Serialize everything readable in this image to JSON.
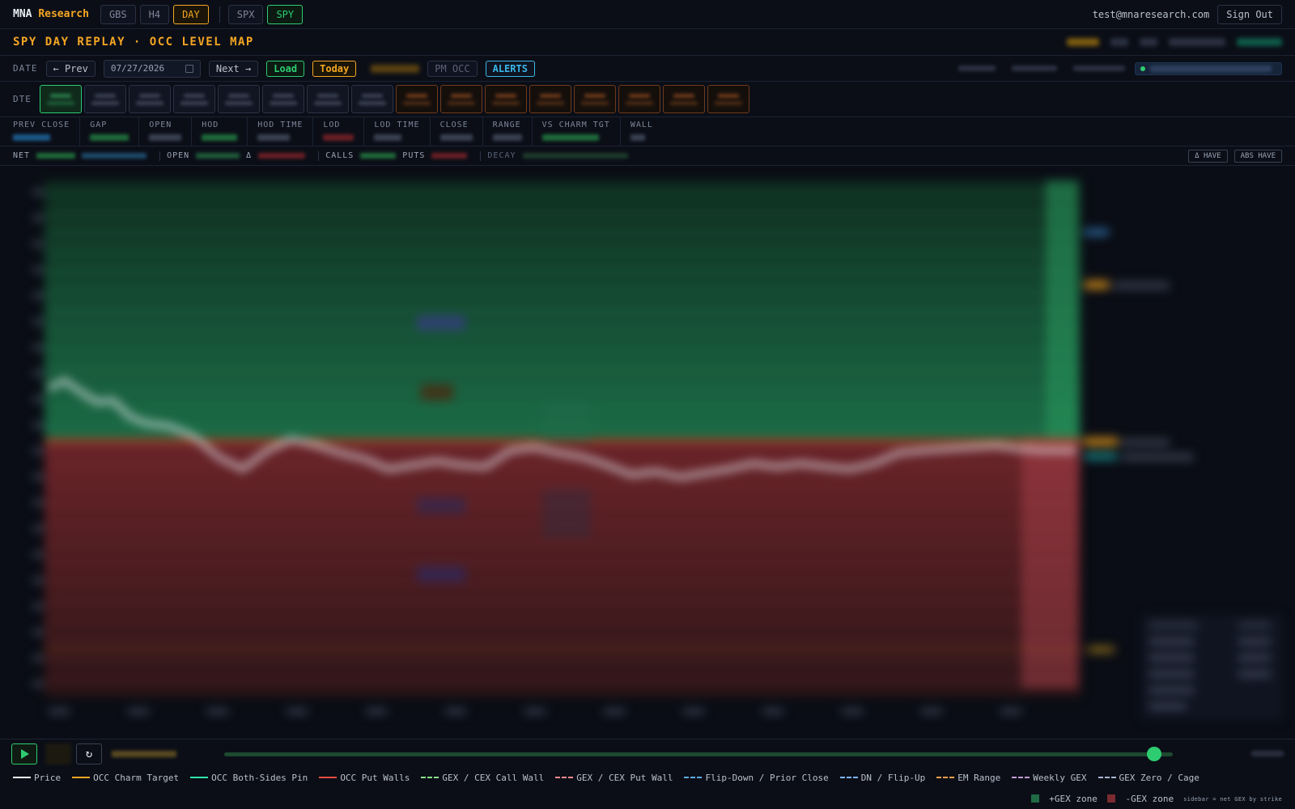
{
  "topbar": {
    "brand_main": "MNA",
    "brand_accent": "Research",
    "modes": [
      "GBS",
      "H4",
      "DAY"
    ],
    "active_mode": "DAY",
    "symbols": [
      "SPX",
      "SPY"
    ],
    "active_symbol": "SPY",
    "user_email": "test@mnaresearch.com",
    "signout_label": "Sign Out"
  },
  "page": {
    "title": "SPY DAY REPLAY · OCC LEVEL MAP"
  },
  "controls": {
    "date_label": "DATE",
    "prev_label": "← Prev",
    "date_value": "07/27/2026",
    "next_label": "Next →",
    "load_label": "Load",
    "today_label": "Today",
    "pm_occ_label": "PM OCC",
    "alerts_label": "ALERTS"
  },
  "dte": {
    "label": "DTE"
  },
  "stats": {
    "labels": [
      "PREV CLOSE",
      "GAP",
      "OPEN",
      "HOD",
      "HOD TIME",
      "LOD",
      "LOD TIME",
      "CLOSE",
      "RANGE",
      "VS CHARM TGT",
      "WALL"
    ]
  },
  "netbar": {
    "net_label": "NET",
    "open_label": "OPEN",
    "delta_label": "Δ",
    "calls_label": "CALLS",
    "puts_label": "PUTS",
    "decay_label": "DECAY",
    "delta_have_label": "Δ HAVE",
    "abs_have_label": "ABS HAVE"
  },
  "player": {
    "reset_icon": "↻",
    "progress": 0.98
  },
  "legend": {
    "items": [
      {
        "label": "Price",
        "color": "#ffffff",
        "style": "solid"
      },
      {
        "label": "OCC Charm Target",
        "color": "#f5a623",
        "style": "solid"
      },
      {
        "label": "OCC Both-Sides Pin",
        "color": "#2ee6a8",
        "style": "solid"
      },
      {
        "label": "OCC Put Walls",
        "color": "#e74c3c",
        "style": "solid"
      },
      {
        "label": "GEX / CEX Call Wall",
        "color": "#8be08b",
        "style": "dashed"
      },
      {
        "label": "GEX / CEX Put Wall",
        "color": "#ff8c8c",
        "style": "dashed"
      },
      {
        "label": "Flip-Down / Prior Close",
        "color": "#5dade2",
        "style": "dashed"
      },
      {
        "label": "DN / Flip-Up",
        "color": "#7fb3ff",
        "style": "dashed"
      },
      {
        "label": "EM Range",
        "color": "#f0a04b",
        "style": "dashed"
      },
      {
        "label": "Weekly GEX",
        "color": "#c39bd3",
        "style": "dashed"
      },
      {
        "label": "GEX Zero / Cage",
        "color": "#a9b7d0",
        "style": "dashed"
      }
    ],
    "zones": [
      {
        "label": "+GEX zone",
        "color": "#1f6b46"
      },
      {
        "label": "-GEX zone",
        "color": "#7a2a30"
      }
    ],
    "footnote": "sidebar = net GEX by strike"
  },
  "colors": {
    "accent": "#f5a623",
    "positive": "#2ecc71",
    "negative": "#e74c3c",
    "info": "#3ab6e8"
  }
}
